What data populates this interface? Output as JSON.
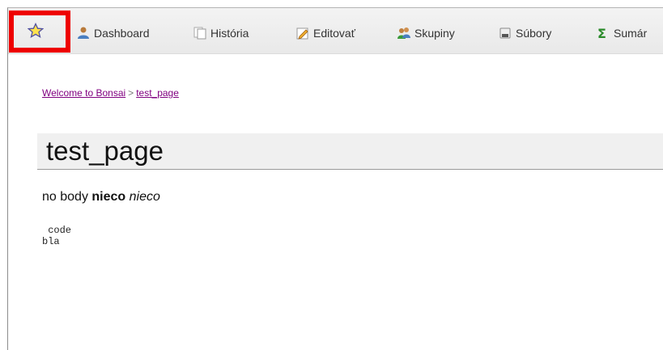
{
  "toolbar": {
    "items": [
      {
        "label": "Dashboard",
        "icon": "users-icon"
      },
      {
        "label": "História",
        "icon": "history-icon"
      },
      {
        "label": "Editovať",
        "icon": "pencil-icon"
      },
      {
        "label": "Skupiny",
        "icon": "group-icon"
      },
      {
        "label": "Súbory",
        "icon": "files-icon"
      },
      {
        "label": "Sumár",
        "icon": "sigma-icon"
      }
    ],
    "favorite_icon": "star-icon"
  },
  "breadcrumb": {
    "home": "Welcome to Bonsai",
    "separator": ">",
    "current": "test_page"
  },
  "page": {
    "title": "test_page",
    "body_plain": "no body ",
    "body_bold": "nieco",
    "body_italic": "nieco",
    "code_lines": [
      " code",
      "bla"
    ]
  },
  "colors": {
    "highlight": "#ee0000",
    "link_visited": "#800080",
    "title_bg": "#f0f0f0"
  }
}
